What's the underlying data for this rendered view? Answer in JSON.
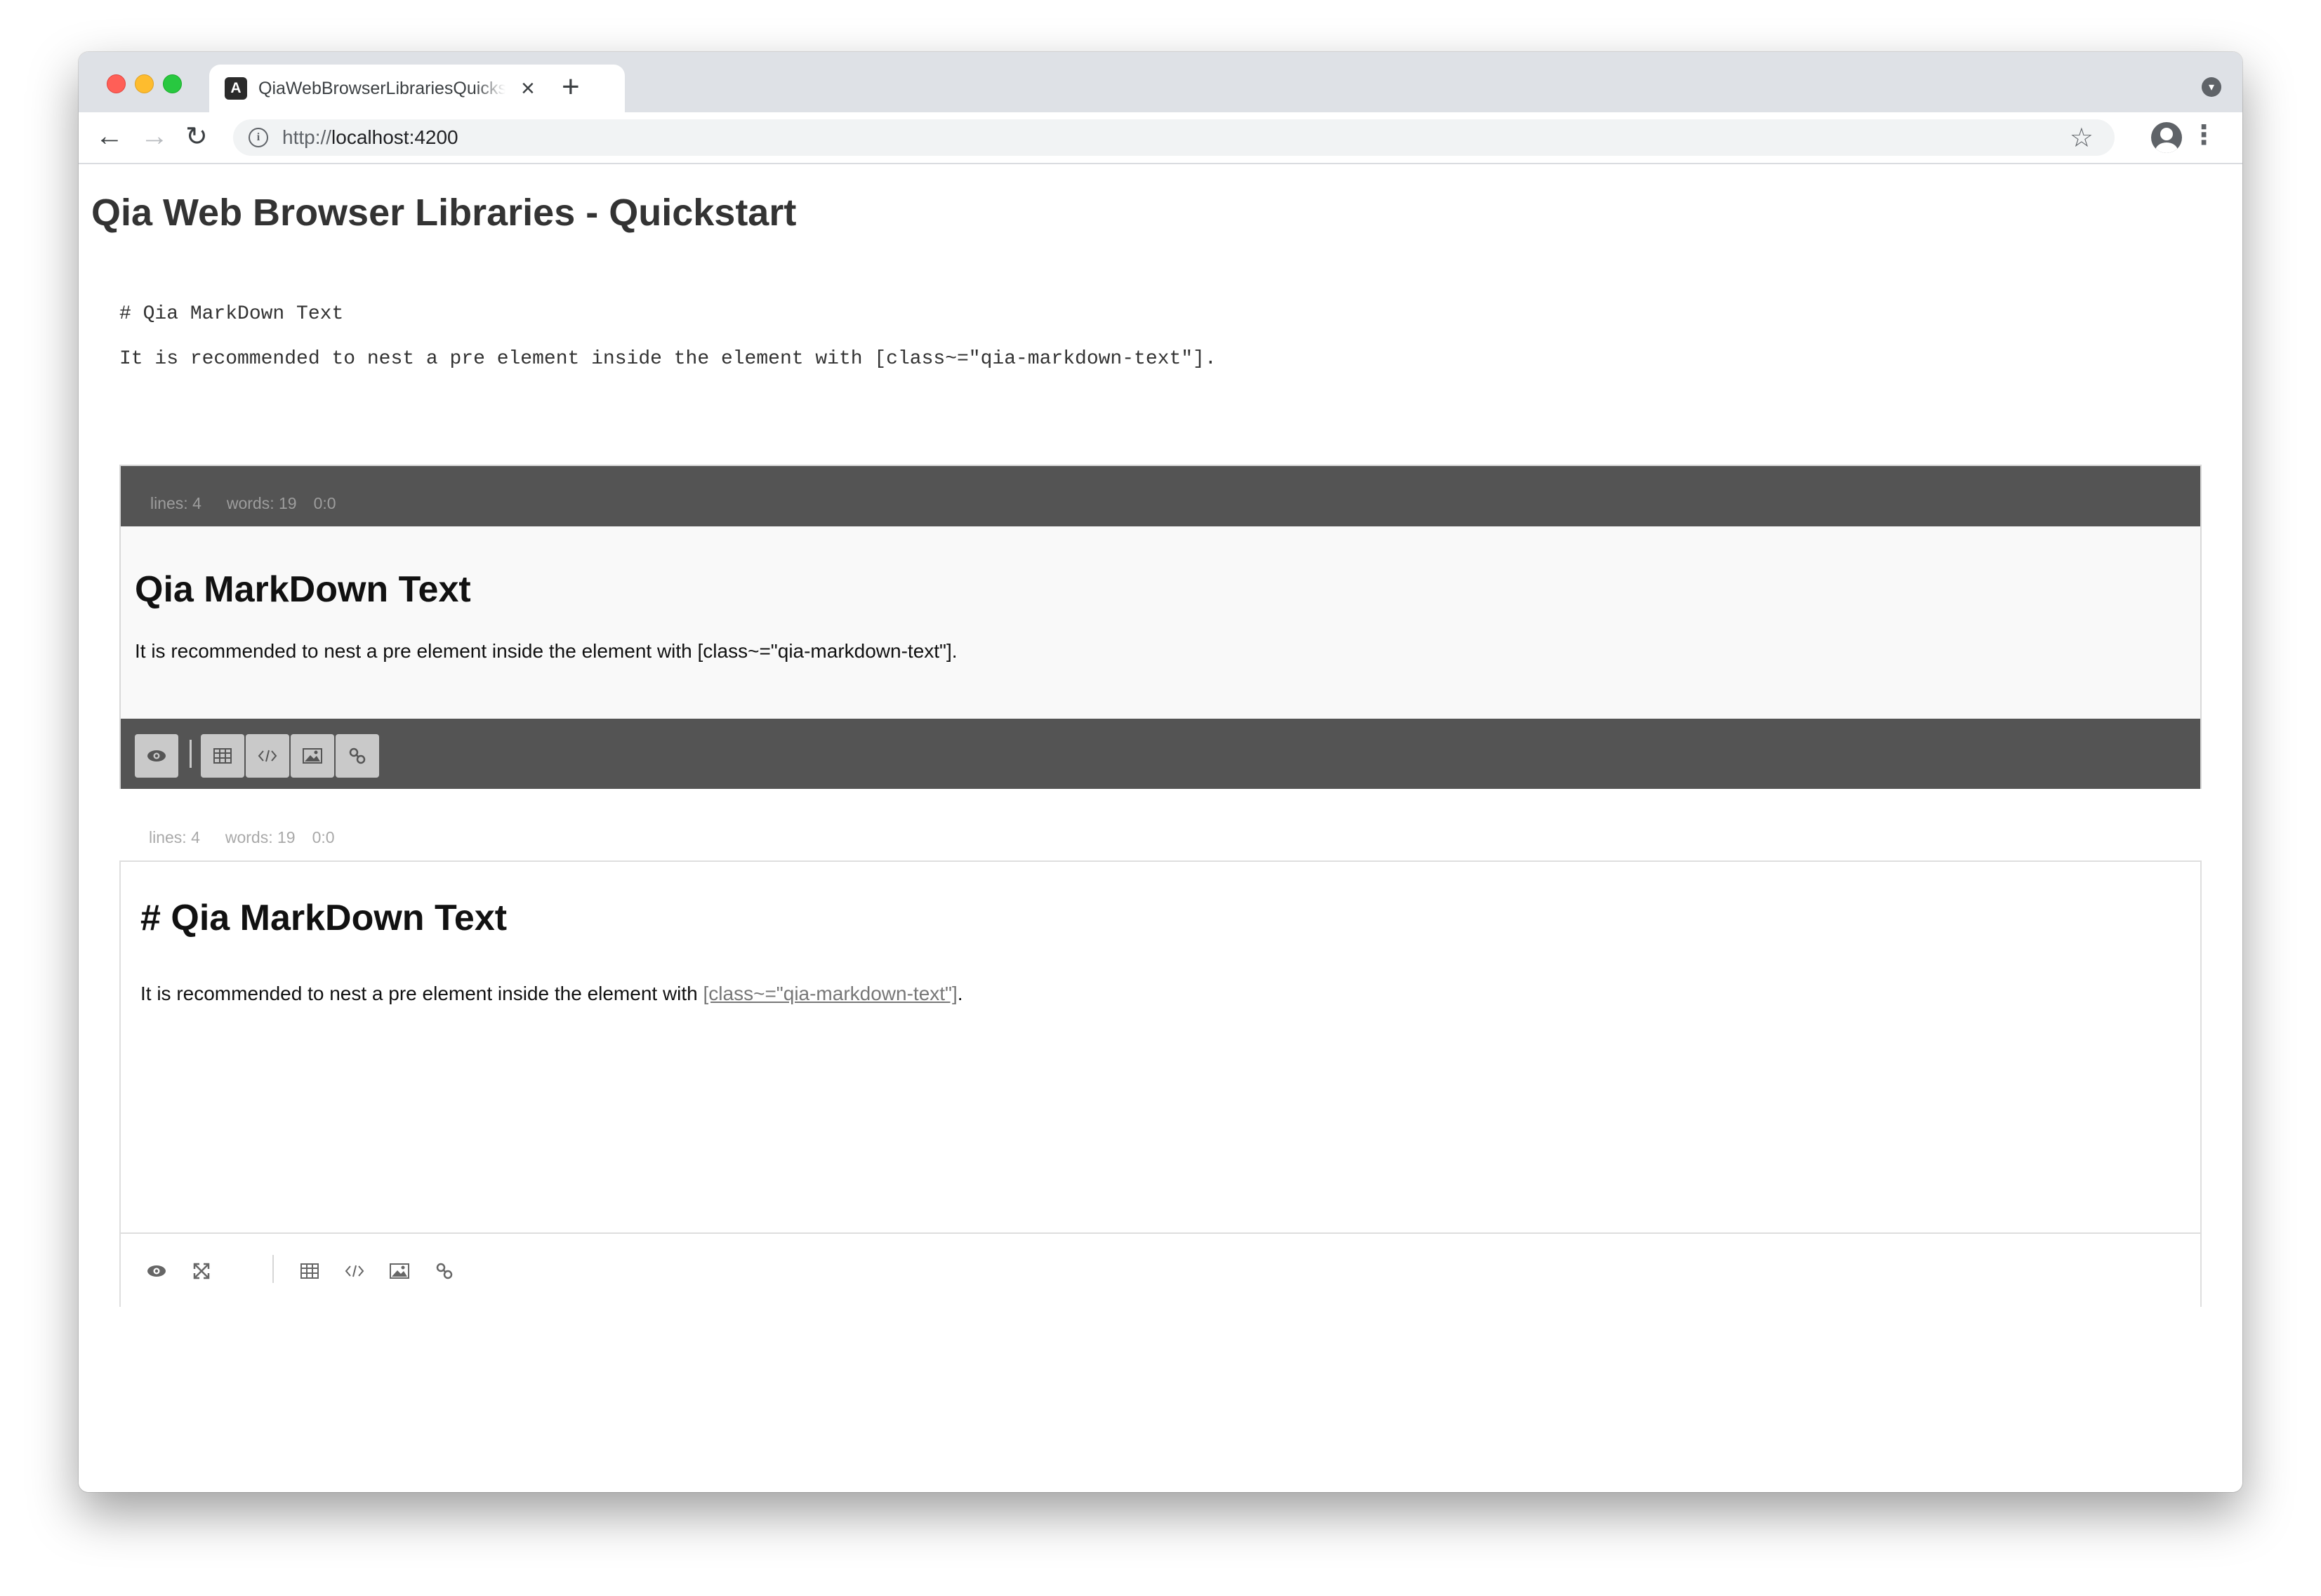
{
  "browser": {
    "tab_title": "QiaWebBrowserLibrariesQuickstart",
    "tab_close": "×",
    "new_tab": "+",
    "url_scheme": "http://",
    "url_host": "localhost",
    "url_port": ":4200"
  },
  "page": {
    "title": "Qia Web Browser Libraries - Quickstart",
    "raw_lines": [
      "# Qia MarkDown Text",
      "It is recommended to nest a pre element inside the element with [class~=\"qia-markdown-text\"]."
    ]
  },
  "editor_dark": {
    "stats": {
      "lines": "lines: 4",
      "words": "words: 19",
      "cursor": "0:0"
    },
    "heading": "Qia MarkDown Text",
    "paragraph": "It is recommended to nest a pre element inside the element with [class~=\"qia-markdown-text\"].",
    "toolbar": [
      "preview-icon",
      "table-icon",
      "code-icon",
      "image-icon",
      "link-icon"
    ]
  },
  "editor_light": {
    "stats": {
      "lines": "lines: 4",
      "words": "words: 19",
      "cursor": "0:0"
    },
    "heading": "# Qia MarkDown Text",
    "paragraph_before": "It is recommended to nest a pre element inside the element with ",
    "paragraph_link": "[class~=\"qia-markdown-text\"]",
    "paragraph_after": ".",
    "toolbar": [
      "preview-icon",
      "fullscreen-icon",
      "table-icon",
      "code-icon",
      "image-icon",
      "link-icon"
    ]
  },
  "colors": {
    "editor_bar": "#545454",
    "editor_button": "#c9c9c9",
    "preview_bg": "#f9f9f9"
  }
}
